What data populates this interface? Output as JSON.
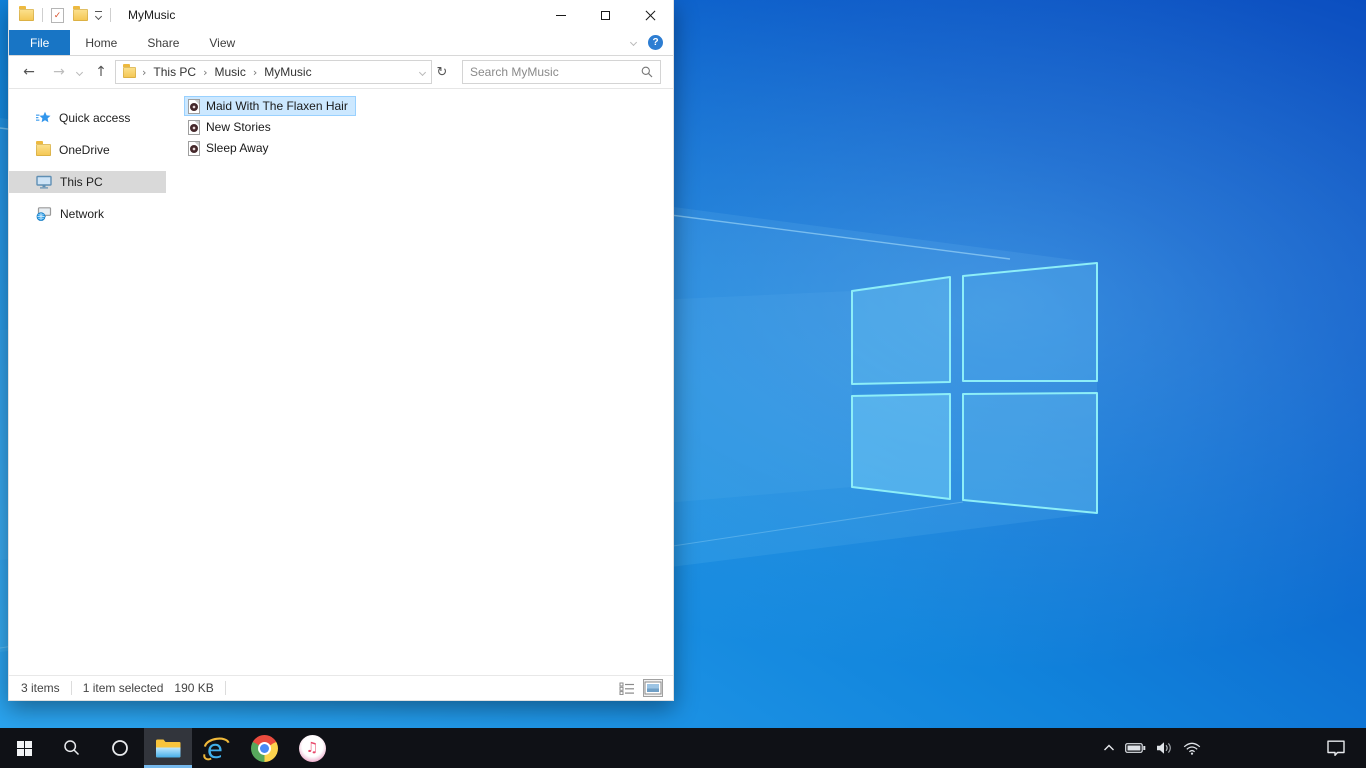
{
  "explorer": {
    "title": "MyMusic",
    "quick_access_toolbar": {
      "icons": [
        "explorer-folder-icon",
        "properties-check-icon",
        "new-folder-icon",
        "customize-caret-icon"
      ],
      "properties_glyph": "✓"
    },
    "window_controls": [
      "minimize",
      "maximize",
      "close"
    ],
    "tabs": [
      {
        "label": "File",
        "active": true
      },
      {
        "label": "Home",
        "active": false
      },
      {
        "label": "Share",
        "active": false
      },
      {
        "label": "View",
        "active": false
      }
    ],
    "ribbon": {
      "collapse_chevron": "ribbon-collapse",
      "help_glyph": "?"
    },
    "navigation": {
      "back": "←",
      "forward": "→",
      "up": "↑",
      "refresh": "↻"
    },
    "breadcrumb": {
      "items": [
        "This PC",
        "Music",
        "MyMusic"
      ],
      "separator": "›"
    },
    "search": {
      "placeholder": "Search MyMusic"
    },
    "sidebar": [
      {
        "label": "Quick access",
        "icon": "quick-access-star",
        "selected": false
      },
      {
        "label": "OneDrive",
        "icon": "folder",
        "selected": false
      },
      {
        "label": "This PC",
        "icon": "monitor",
        "selected": true
      },
      {
        "label": "Network",
        "icon": "network-pc",
        "selected": false
      }
    ],
    "files": [
      {
        "name": "Maid With The Flaxen Hair",
        "type": "audio",
        "selected": true
      },
      {
        "name": "New Stories",
        "type": "audio",
        "selected": false
      },
      {
        "name": "Sleep Away",
        "type": "audio",
        "selected": false
      }
    ],
    "statusbar": {
      "items_count": "3 items",
      "selection": "1 item selected",
      "selection_size": "190 KB",
      "view_buttons": [
        "details-view",
        "large-icons-view"
      ]
    }
  },
  "taskbar": {
    "buttons": [
      "start",
      "search",
      "cortana",
      "file-explorer",
      "internet-explorer",
      "chrome",
      "itunes"
    ],
    "active_button": "file-explorer",
    "ie_letter": "e",
    "itunes_note_glyph": "♫",
    "tray_icons": [
      "hidden-icons-chevron",
      "battery",
      "volume",
      "wifi"
    ],
    "action_center": "action-center"
  },
  "colors": {
    "file_tab_blue": "#1875c5",
    "selection_bg": "#cce8ff",
    "selection_border": "#99d1ff",
    "sidebar_selected_bg": "#d9d9d9",
    "help_icon_blue": "#2d7dd2",
    "taskbar_bg": "#0f1116",
    "taskbar_active_underline": "#76b9ed",
    "wallpaper_bright": "#2aa3ee",
    "wallpaper_mid": "#1184dc",
    "wallpaper_deep": "#0b52c2",
    "logo_stroke": "#8deef8"
  }
}
